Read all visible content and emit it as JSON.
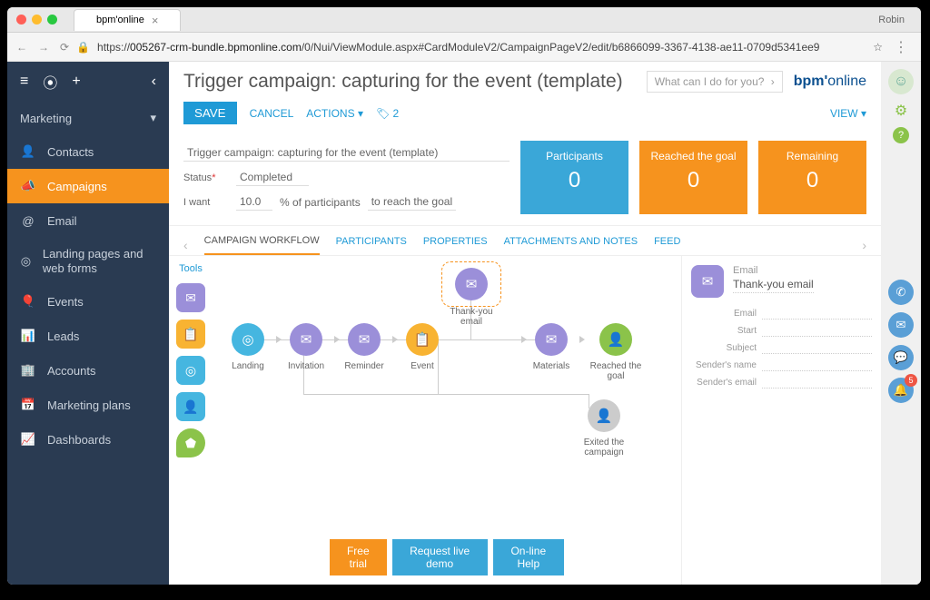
{
  "browser": {
    "tab_title": "bpm'online",
    "user": "Robin",
    "url_host": "005267-crm-bundle.bpmonline.com",
    "url_path": "/0/Nui/ViewModule.aspx#CardModuleV2/CampaignPageV2/edit/b6866099-3367-4138-ae11-0709d5341ee9"
  },
  "sidebar": {
    "section": "Marketing",
    "items": [
      {
        "label": "Contacts"
      },
      {
        "label": "Campaigns"
      },
      {
        "label": "Email"
      },
      {
        "label": "Landing pages and web forms"
      },
      {
        "label": "Events"
      },
      {
        "label": "Leads"
      },
      {
        "label": "Accounts"
      },
      {
        "label": "Marketing plans"
      },
      {
        "label": "Dashboards"
      }
    ]
  },
  "header": {
    "title": "Trigger campaign: capturing for the event (template)",
    "search_placeholder": "What can I do for you?",
    "logo": "bpm'online"
  },
  "toolbar": {
    "save": "SAVE",
    "cancel": "CANCEL",
    "actions": "ACTIONS",
    "tag_count": "2",
    "view": "VIEW"
  },
  "form": {
    "title": "Trigger campaign: capturing for the event (template)",
    "status_label": "Status",
    "status_value": "Completed",
    "iwant": "I want",
    "pct_value": "10.0",
    "pct_label": "% of participants",
    "goal_label": "to reach the goal"
  },
  "stats": [
    {
      "title": "Participants",
      "value": "0",
      "color": "blue"
    },
    {
      "title": "Reached the goal",
      "value": "0",
      "color": "orange"
    },
    {
      "title": "Remaining",
      "value": "0",
      "color": "orange"
    }
  ],
  "tabs": [
    "CAMPAIGN WORKFLOW",
    "PARTICIPANTS",
    "PROPERTIES",
    "ATTACHMENTS AND NOTES",
    "FEED"
  ],
  "tools_label": "Tools",
  "nodes": {
    "landing": "Landing",
    "invitation": "Invitation",
    "reminder": "Reminder",
    "event": "Event",
    "thankyou": "Thank-you email",
    "materials": "Materials",
    "reached": "Reached the goal",
    "exited": "Exited the campaign"
  },
  "details": {
    "type": "Email",
    "title": "Thank-you email",
    "fields": [
      "Email",
      "Start",
      "Subject",
      "Sender's name",
      "Sender's email"
    ]
  },
  "rightrail": {
    "badge": "5"
  },
  "footer": {
    "free": "Free trial",
    "demo": "Request live demo",
    "help": "On-line Help"
  }
}
